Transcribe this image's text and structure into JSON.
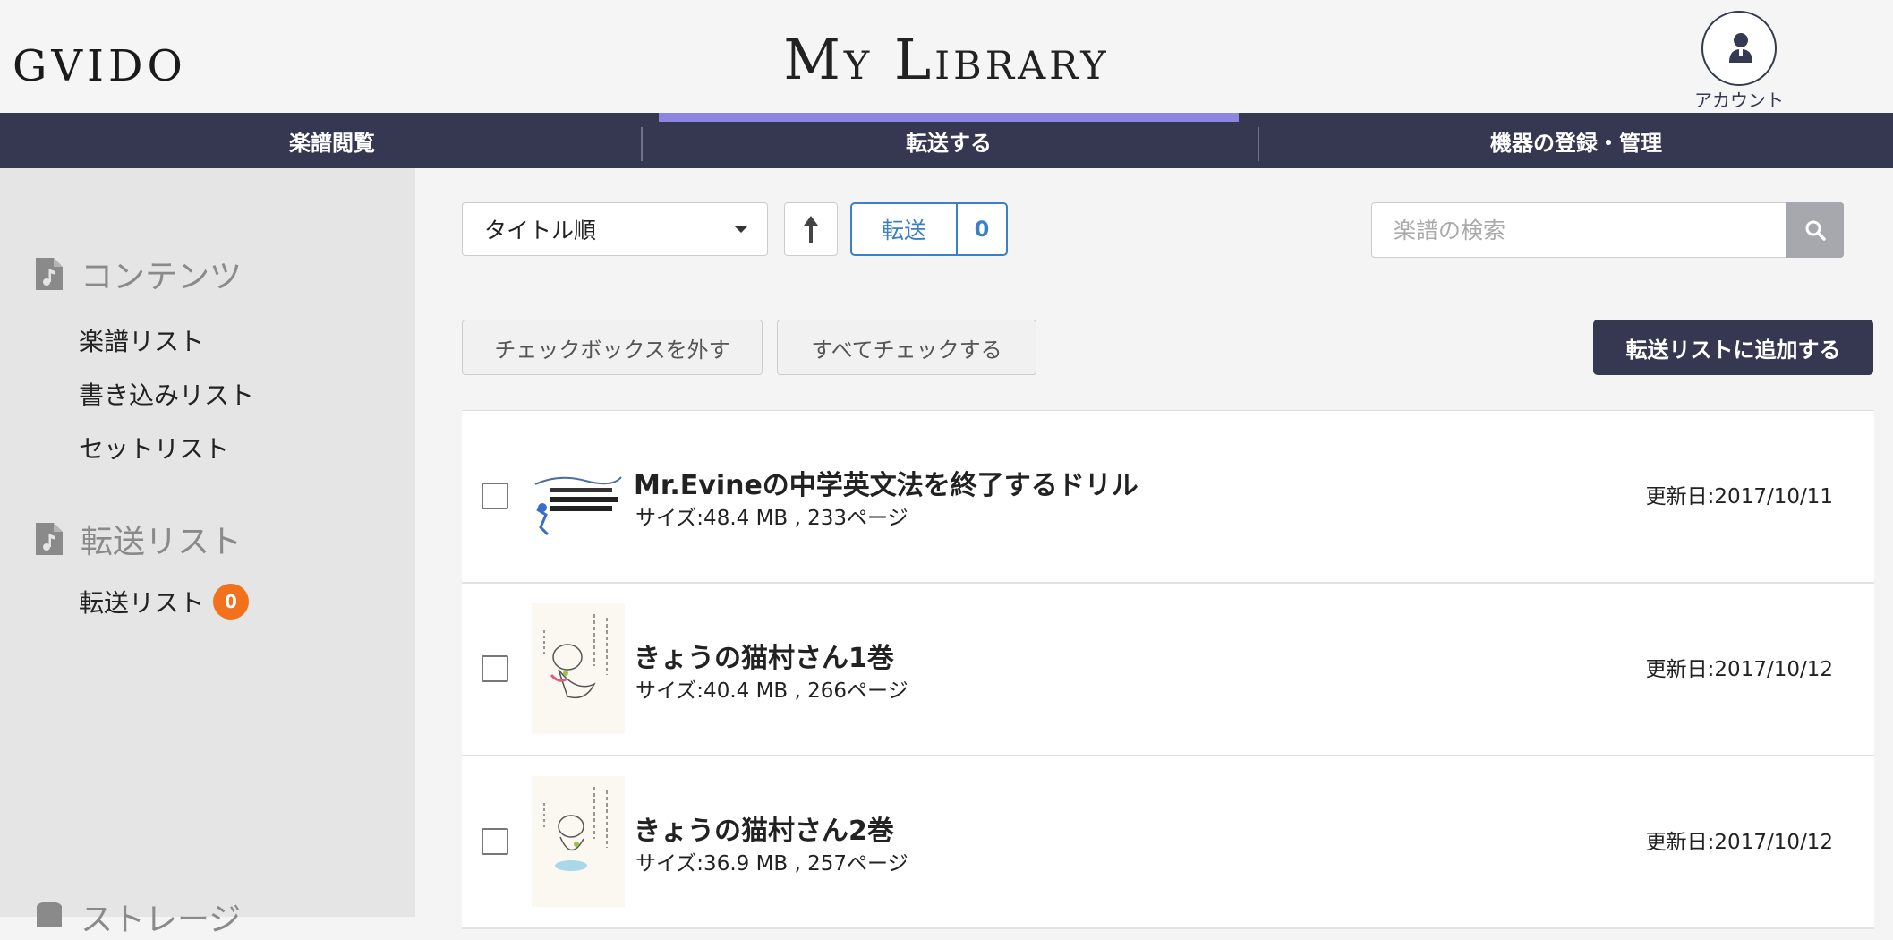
{
  "header": {
    "logo": "GVIDO",
    "title": "My Library",
    "account_label": "アカウント"
  },
  "nav": {
    "tabs": [
      {
        "label": "楽譜閲覧",
        "active": false
      },
      {
        "label": "転送する",
        "active": true
      },
      {
        "label": "機器の登録・管理",
        "active": false
      }
    ],
    "active_color": "#8c86e0"
  },
  "sidebar": {
    "sections": [
      {
        "label": "コンテンツ",
        "icon": "music-file-icon",
        "items": [
          "楽譜リスト",
          "書き込みリスト",
          "セットリスト"
        ]
      },
      {
        "label": "転送リスト",
        "icon": "music-file-icon",
        "items": [
          "転送リスト"
        ]
      },
      {
        "label": "ストレージ",
        "icon": "storage-icon",
        "items": []
      }
    ],
    "transfer_badge": "0",
    "badge_color": "#f2711c"
  },
  "toolbar": {
    "sort_value": "タイトル順",
    "sort_direction_icon": "arrow-up-icon",
    "transfer_label": "転送",
    "transfer_count": "0",
    "search_placeholder": "楽譜の検索",
    "uncheck_all": "チェックボックスを外す",
    "check_all": "すべてチェックする",
    "add_to_transfer": "転送リストに追加する"
  },
  "items": [
    {
      "title": "Mr.Evineの中学英文法を終了するドリル",
      "meta": "サイズ:48.4 MB , 233ページ",
      "date": "更新日:2017/10/11",
      "checked": false
    },
    {
      "title": "きょうの猫村さん1巻",
      "meta": "サイズ:40.4 MB , 266ページ",
      "date": "更新日:2017/10/12",
      "checked": false
    },
    {
      "title": "きょうの猫村さん2巻",
      "meta": "サイズ:36.9 MB , 257ページ",
      "date": "更新日:2017/10/12",
      "checked": false
    }
  ]
}
